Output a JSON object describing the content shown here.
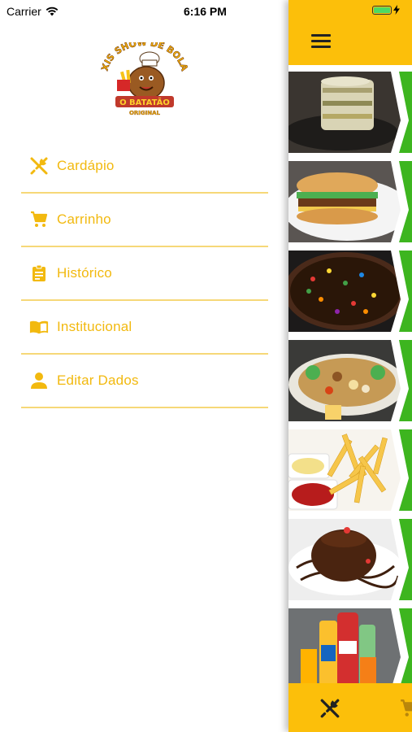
{
  "status_bar": {
    "carrier": "Carrier",
    "time": "6:16 PM",
    "battery_percent": 100,
    "icons": [
      "wifi-icon",
      "battery-icon",
      "charging-bolt-icon"
    ]
  },
  "logo": {
    "text_top": "XIS SHOW DE BOLA",
    "text_bottom": "O BATATÃO",
    "text_sub": "ORIGINAL"
  },
  "menu": {
    "items": [
      {
        "label": "Cardápio",
        "icon": "fork-knife-icon"
      },
      {
        "label": "Carrinho",
        "icon": "cart-icon"
      },
      {
        "label": "Histórico",
        "icon": "clipboard-icon"
      },
      {
        "label": "Institucional",
        "icon": "book-icon"
      },
      {
        "label": "Editar Dados",
        "icon": "person-icon"
      }
    ]
  },
  "main": {
    "header_icon": "hamburger-menu-icon",
    "categories": [
      {
        "image": "layered-potato-dish"
      },
      {
        "image": "burger-sandwich"
      },
      {
        "image": "chocolate-pizza"
      },
      {
        "image": "mixed-platter"
      },
      {
        "image": "fries-with-sauces"
      },
      {
        "image": "chocolate-lava-cake"
      },
      {
        "image": "soft-drinks"
      }
    ],
    "footer_icons": [
      "fork-knife-icon",
      "cart-icon"
    ]
  },
  "colors": {
    "accent": "#fcbf0a",
    "menu_text": "#f2b90f",
    "divider": "#f6d878",
    "green_stripe": "#3db51f"
  }
}
